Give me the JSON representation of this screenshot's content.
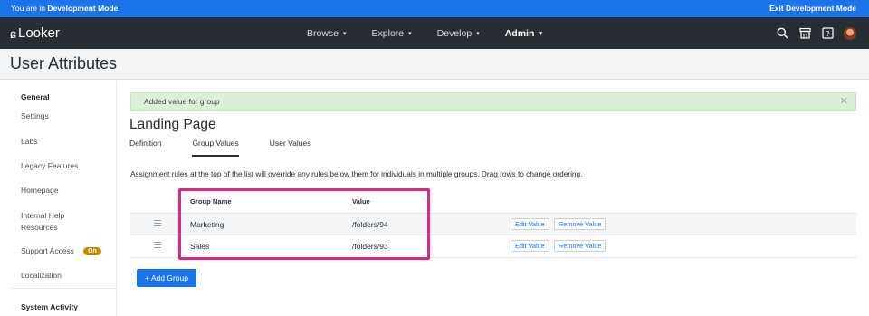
{
  "devbar": {
    "prefix": "You are in ",
    "mode": "Development Mode.",
    "exit_label": "Exit Development Mode"
  },
  "nav": {
    "logo": "Looker",
    "items": [
      {
        "label": "Browse",
        "active": false
      },
      {
        "label": "Explore",
        "active": false
      },
      {
        "label": "Develop",
        "active": false
      },
      {
        "label": "Admin",
        "active": true
      }
    ]
  },
  "page": {
    "title": "User Attributes"
  },
  "sidebar": {
    "items": [
      {
        "label": "General",
        "type": "heading"
      },
      {
        "label": "Settings"
      },
      {
        "label": "Labs"
      },
      {
        "label": "Legacy Features"
      },
      {
        "label": "Homepage"
      },
      {
        "label": "Internal Help",
        "label2": "Resources"
      },
      {
        "label": "Support Access",
        "badge": "On"
      },
      {
        "label": "Localization"
      },
      {
        "label": "System Activity",
        "type": "heading"
      }
    ]
  },
  "alert": {
    "message": "Added value for group"
  },
  "attribute": {
    "title": "Landing Page"
  },
  "tabs": [
    {
      "label": "Definition",
      "active": false
    },
    {
      "label": "Group Values",
      "active": true
    },
    {
      "label": "User Values",
      "active": false
    }
  ],
  "description": "Assignment rules at the top of the list will override any rules below them for individuals in multiple groups. Drag rows to change ordering.",
  "table": {
    "columns": {
      "group": "Group Name",
      "value": "Value"
    },
    "rows": [
      {
        "group": "Marketing",
        "value": "/folders/94"
      },
      {
        "group": "Sales",
        "value": "/folders/93"
      }
    ],
    "edit_label": "Edit Value",
    "remove_label": "Remove Value"
  },
  "add_group_label": "+ Add Group",
  "colors": {
    "devbar": "#1a73e8",
    "navbar": "#262d33",
    "accent": "#1a73e8",
    "highlight": "#e0257a",
    "badge": "#c28a00"
  }
}
